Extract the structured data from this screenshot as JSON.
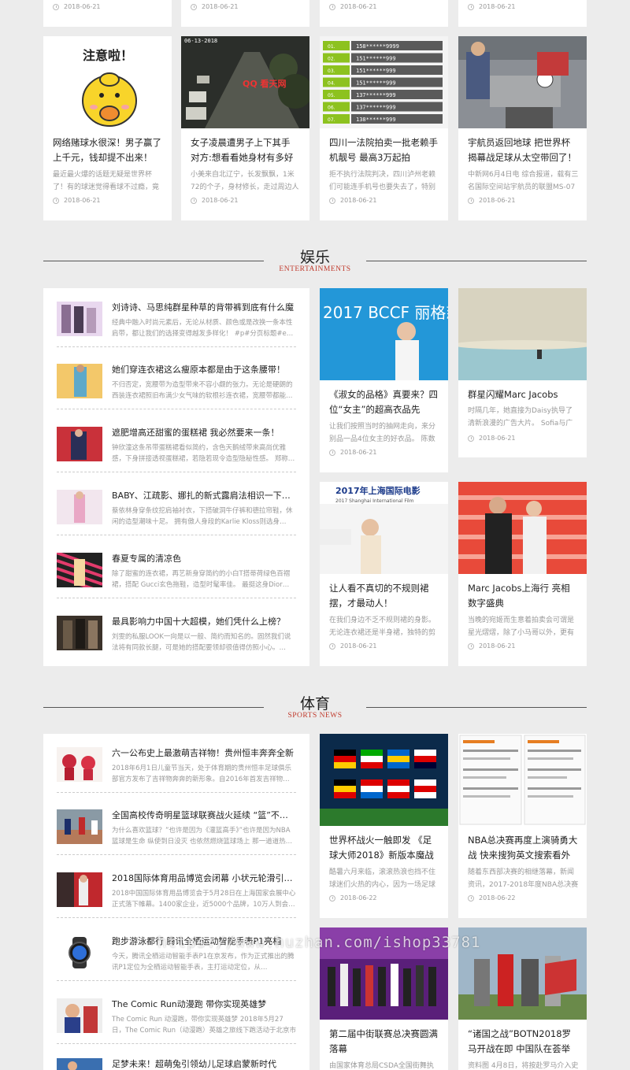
{
  "top_row_dates": [
    "2018-06-21",
    "2018-06-21",
    "2018-06-21",
    "2018-06-21"
  ],
  "news_cards": [
    {
      "title": "网络赌球水很深！男子赢了上千元，钱却提不出来！",
      "desc": "最近最火爆的话题无疑是世界杯了！有的球迷觉得看球不过瘾，竟然还在网…",
      "date": "2018-06-21",
      "thumb_text": "注意啦！"
    },
    {
      "title": "女子凌晨遭男子上下其手 对方:想看看她身材有多好",
      "desc": "小美来自北辽宁，长发飘飘，1米72的个子，身材修长，走过周边人羡慕…",
      "date": "2018-06-21",
      "thumb_text": "06-13-2018",
      "thumb_logo": "QQ 看天网"
    },
    {
      "title": "四川一法院拍卖一批老赖手机靓号 最高3万起拍",
      "desc": "拒不执行法院判决，四川泸州老赖们可能连手机号也要失去了，特别是一些…",
      "date": "2018-06-21",
      "thumb_numbers": [
        "158******9999",
        "151******999",
        "151******999",
        "151******999",
        "137******999",
        "137******999",
        "138******999"
      ],
      "thumb_tags": [
        "01.",
        "02.",
        "03.",
        "04.",
        "05.",
        "06.",
        "07."
      ]
    },
    {
      "title": "宇航员返回地球 把世界杯揭幕战足球从太空带回了！",
      "desc": "中新网6月4日电 综合报道，载有三名国际空间站宇航员的联盟MS-07飞船…",
      "date": "2018-06-21"
    }
  ],
  "entertainment": {
    "title_zh": "娱乐",
    "title_en": "ENTERTAINMENTS",
    "list": [
      {
        "title": "刘诗诗、马思纯群星种草的背带裤到底有什么魔",
        "desc": "经典中融入时尚元素后，无论从材质、颜色或是改换一条本性肩带，都让我们的选择变得越发多样化！ #p#分页标题#e…"
      },
      {
        "title": "她们穿连衣裙这么瘦原本都是由于这条腰带！",
        "desc": "不归否定，宽腰带为造型带来不容小觑的张力。无论是硬朗的西装连衣裙照旧布满少女气味的软根衫连衣裙，宽腰带都能…"
      },
      {
        "title": "遮肥增高还甜蜜的蛋糕裙 我必然要来一条！",
        "desc": "钟欣潼这条吊带蛋糕裙看似简约，含色天鹅绒带来高尚优雅感，下身拼接透视蛋糕裙，若隐若现令造型隐秘性感。 郑称…"
      },
      {
        "title": "BABY、江疏影、娜扎的新式露肩法相识一下…",
        "desc": "蔡依林身穿条纹挖肩袖衬衣，下搭破洞牛仔裤和德拉帘鞋，休闲的造型潮味十足。 拥有傲人身段的Karlie Kloss则选身…"
      },
      {
        "title": "春夏专属的清凉色",
        "desc": "除了甜蜜的连衣裙，再艺新身穿简约的小白T搭蒂荷绿色百褶裙，搭配 Gucci玄色拖鞋，造型时髦率佳。 最挺这身Dior…"
      },
      {
        "title": "最具影响力中国十大超模，她们凭什么上榜？",
        "desc": "刘雯的私服LOOK一向是以一般、简约而知名的。固然我们说法将有同款长腿，可是她的搭配要领却很值得仿照小心。…"
      }
    ],
    "cards": [
      {
        "title": "《淑女的品格》真要来？四位“女主”的超高衣品先",
        "desc": "让我们按照当时的抽网走向，来分别品一品4位女主的好衣品。 陈数的设定…",
        "date": "2018-06-21",
        "thumb_text": "2017 BCCF 丽格慈善基金会 启动仪式"
      },
      {
        "title": "群星闪耀Marc Jacobs",
        "desc": "时隔几年，她直接为Daisy执导了清新浪漫的广告大片。 Sofia与广告模特…",
        "date": "2018-06-21"
      },
      {
        "title": "让人看不真切的不规则裙摆，才最动人！",
        "desc": "在我们身边不乏不规则裙的身影。无论连衣裙还是半身裙，独特的剪裁技艺…",
        "date": "2018-06-21",
        "thumb_text": "2017年上海国际电影 2017 Shanghai International Film"
      },
      {
        "title": "Marc Jacobs上海行 亮相数字盛典",
        "desc": "当晚的宛姬而生意着拍卖会可谓是星光熠熠，除了小马哥以外，更有众多当…",
        "date": "2018-06-21"
      }
    ]
  },
  "sports": {
    "title_zh": "体育",
    "title_en": "SPORTS NEWS",
    "list": [
      {
        "title": "六一公布史上最激萌吉祥物！贵州恒丰奔奔全新",
        "desc": "2018年6月1日儿童节当天，处于体育期的贵州恒丰足球俱乐部官方发布了吉祥物奔奔的新形象。自2016年首发吉祥物…"
      },
      {
        "title": "全国高校传奇明星篮球联赛战火延续 “篮”不…",
        "desc": "为什么喜欢篮球？”也许是因为《灌篮高手》”也许是因为NBA 篮球是生命 纵使到日没灭 也依然燃烧篮球场上 那一道道热…"
      },
      {
        "title": "2018国际体育用品博览会闭幕 小状元轮滑引…",
        "desc": "2018中国国际体育用品博览会于5月28日在上海国家会展中心正式落下帷幕。1400家企业，近5000个品牌，10万人到会…"
      },
      {
        "title": "跑步游泳都行 腾讯全栖运动智能手表P1亮相",
        "desc": "今天，腾讯全栖运动智能手表P1在京发布，作为正式推出的腾讯P1定位为全栖运动智能手表，主打运动定位，从…"
      },
      {
        "title": "The Comic Run动漫跑 带你实现英雄梦",
        "desc": "The Comic Run 动漫跑，带你实现英雄梦 2018年5月27日，The Comic Run（动漫跑）英雄之旅线下跑活动于北京市郊…"
      },
      {
        "title": "足梦未来！超萌兔引领幼儿足球启蒙新时代",
        "desc": ""
      }
    ],
    "cards": [
      {
        "title": "世界杯战火一触即发 《足球大师2018》新版本魔战俄罗",
        "desc": "酷暑六月来临，滚滚热浪也挡不住球迷们火热的内心，因为一场足球盛会…",
        "date": "2018-06-22"
      },
      {
        "title": "NBA总决赛再度上演骑勇大战 快来搜狗英文搜索看外媒",
        "desc": "随着东西部决赛的相继落幕，新闻资讯，2017-2018年度NBA总决赛已于…",
        "date": "2018-06-22"
      },
      {
        "title": "第二届中街联赛总决赛圆满落幕",
        "desc": "由国家体育总局CSDA全国街舞执行委…",
        "date": ""
      },
      {
        "title": "“诸国之战”BOTN2018罗马开战在即 中国队在荟举办赛",
        "desc": "资料图 4月8日，将按赴罗马介入史实…",
        "date": ""
      }
    ]
  },
  "watermark": "https://www.huzhan.com/ishop33781",
  "colors": {
    "accent_red": "#c0392b",
    "background": "#ececec",
    "card": "#ffffff",
    "green_tag": "#8dc21f"
  }
}
